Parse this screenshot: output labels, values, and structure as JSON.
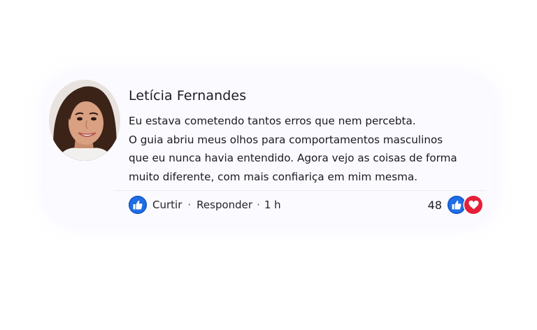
{
  "comment": {
    "author": "Letícia Fernandes",
    "text_lines": [
      "Eu estava cometendo tantos erros que nem percebta.",
      "O guia abriu meus olhos para comportamentos masculinos",
      "que eu nunca havia entendido. Agora vejo as coisas de forma",
      "muito diferente, com mais confiariça em mim mesma."
    ],
    "like_label": "Curtir",
    "reply_label": "Responder",
    "separator": "·",
    "time": "1 h",
    "reaction_count": "48"
  },
  "colors": {
    "like_blue": "#1f6ee6",
    "heart_red": "#e5203a"
  },
  "icons": [
    "thumbs-up-icon",
    "heart-icon"
  ]
}
